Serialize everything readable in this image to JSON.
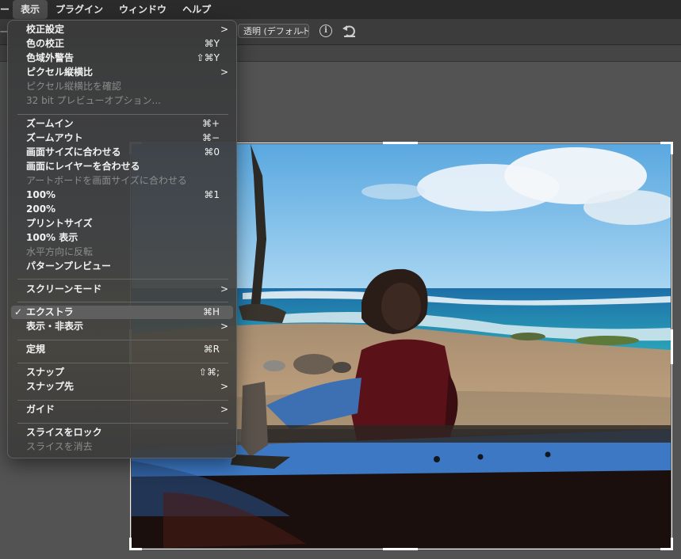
{
  "menubar": {
    "stub": "ー",
    "items": [
      "表示",
      "プラグイン",
      "ウィンドウ",
      "ヘルプ"
    ],
    "active": "表示"
  },
  "options": {
    "stub": "一",
    "background_select": "透明 (デフォルト)",
    "info_icon": "info-icon",
    "rotate_icon": "rotate-ccw-icon"
  },
  "menu": {
    "items": [
      {
        "label": "校正設定",
        "shortcut": "",
        "submenu": true,
        "disabled": false,
        "checked": false
      },
      {
        "label": "色の校正",
        "shortcut": "⌘Y",
        "submenu": false,
        "disabled": false,
        "checked": false
      },
      {
        "label": "色域外警告",
        "shortcut": "⇧⌘Y",
        "submenu": false,
        "disabled": false,
        "checked": false
      },
      {
        "label": "ピクセル縦横比",
        "shortcut": "",
        "submenu": true,
        "disabled": false,
        "checked": false
      },
      {
        "label": "ピクセル縦横比を確認",
        "shortcut": "",
        "submenu": false,
        "disabled": true,
        "checked": false
      },
      {
        "label": "32 bit プレビューオプション...",
        "shortcut": "",
        "submenu": false,
        "disabled": true,
        "checked": false
      },
      {
        "label": "ズームイン",
        "shortcut": "⌘+",
        "submenu": false,
        "disabled": false,
        "checked": false
      },
      {
        "label": "ズームアウト",
        "shortcut": "⌘−",
        "submenu": false,
        "disabled": false,
        "checked": false
      },
      {
        "label": "画面サイズに合わせる",
        "shortcut": "⌘0",
        "submenu": false,
        "disabled": false,
        "checked": false
      },
      {
        "label": "画面にレイヤーを合わせる",
        "shortcut": "",
        "submenu": false,
        "disabled": false,
        "checked": false
      },
      {
        "label": "アートボードを画面サイズに合わせる",
        "shortcut": "",
        "submenu": false,
        "disabled": true,
        "checked": false
      },
      {
        "label": "100%",
        "shortcut": "⌘1",
        "submenu": false,
        "disabled": false,
        "checked": false
      },
      {
        "label": "200%",
        "shortcut": "",
        "submenu": false,
        "disabled": false,
        "checked": false
      },
      {
        "label": "プリントサイズ",
        "shortcut": "",
        "submenu": false,
        "disabled": false,
        "checked": false
      },
      {
        "label": "100% 表示",
        "shortcut": "",
        "submenu": false,
        "disabled": false,
        "checked": false
      },
      {
        "label": "水平方向に反転",
        "shortcut": "",
        "submenu": false,
        "disabled": true,
        "checked": false
      },
      {
        "label": "パターンプレビュー",
        "shortcut": "",
        "submenu": false,
        "disabled": false,
        "checked": false
      },
      {
        "label": "スクリーンモード",
        "shortcut": "",
        "submenu": true,
        "disabled": false,
        "checked": false
      },
      {
        "label": "エクストラ",
        "shortcut": "⌘H",
        "submenu": false,
        "disabled": false,
        "checked": true
      },
      {
        "label": "表示・非表示",
        "shortcut": "",
        "submenu": true,
        "disabled": false,
        "checked": false
      },
      {
        "label": "定規",
        "shortcut": "⌘R",
        "submenu": false,
        "disabled": false,
        "checked": false
      },
      {
        "label": "スナップ",
        "shortcut": "⇧⌘;",
        "submenu": false,
        "disabled": false,
        "checked": false
      },
      {
        "label": "スナップ先",
        "shortcut": "",
        "submenu": true,
        "disabled": false,
        "checked": false
      },
      {
        "label": "ガイド",
        "shortcut": "",
        "submenu": true,
        "disabled": false,
        "checked": false
      },
      {
        "label": "スライスをロック",
        "shortcut": "",
        "submenu": false,
        "disabled": false,
        "checked": false
      },
      {
        "label": "スライスを消去",
        "shortcut": "",
        "submenu": false,
        "disabled": true,
        "checked": false
      }
    ],
    "check_glyph": "✓",
    "submenu_glyph": ">"
  }
}
